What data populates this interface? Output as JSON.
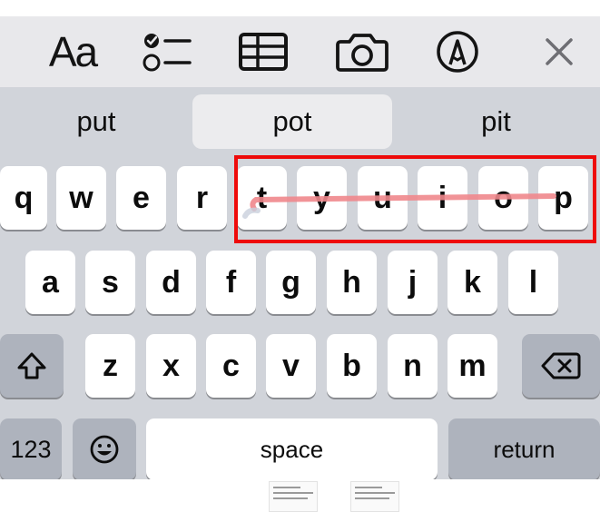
{
  "toolbar": {
    "text_format_label": "Aa",
    "icons": [
      "checklist-icon",
      "table-icon",
      "camera-icon",
      "markup-icon",
      "close-icon"
    ]
  },
  "predictive": {
    "left": "put",
    "center": "pot",
    "right": "pit",
    "selected": "center"
  },
  "keyboard": {
    "row1": [
      "q",
      "w",
      "e",
      "r",
      "t",
      "y",
      "u",
      "i",
      "o",
      "p"
    ],
    "row2": [
      "a",
      "s",
      "d",
      "f",
      "g",
      "h",
      "j",
      "k",
      "l"
    ],
    "row3": [
      "z",
      "x",
      "c",
      "v",
      "b",
      "n",
      "m"
    ],
    "numbers_label": "123",
    "space_label": "space",
    "return_label": "return",
    "shift_icon": "shift-icon",
    "emoji_icon": "emoji-icon",
    "delete_icon": "delete-icon"
  },
  "annotation": {
    "box_color": "#ee0a0a",
    "swipe_color": "#f0878c",
    "highlighted_keys": [
      "t",
      "y",
      "u",
      "i",
      "o",
      "p"
    ]
  },
  "colors": {
    "toolbar_bg": "#e8e8eb",
    "keyboard_bg": "#d1d4da",
    "key_bg": "#ffffff",
    "function_key_bg": "#aeb3bd"
  }
}
